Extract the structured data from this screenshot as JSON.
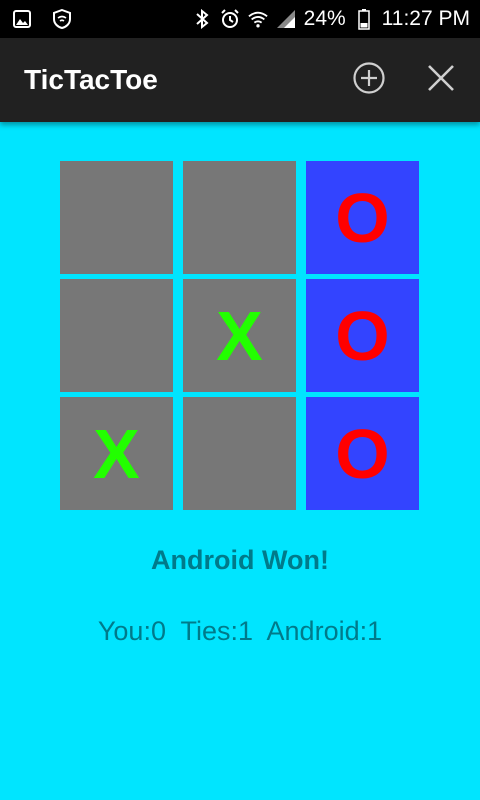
{
  "status_bar": {
    "battery": "24%",
    "time": "11:27 PM"
  },
  "app_bar": {
    "title": "TicTacToe"
  },
  "board": [
    {
      "mark": "",
      "winning": false
    },
    {
      "mark": "",
      "winning": false
    },
    {
      "mark": "O",
      "winning": true
    },
    {
      "mark": "",
      "winning": false
    },
    {
      "mark": "X",
      "winning": false
    },
    {
      "mark": "O",
      "winning": true
    },
    {
      "mark": "X",
      "winning": false
    },
    {
      "mark": "",
      "winning": false
    },
    {
      "mark": "O",
      "winning": true
    }
  ],
  "colors": {
    "background": "#00e5ff",
    "empty_cell": "#777777",
    "winning_cell": "#3344ff",
    "x_mark": "#22ff00",
    "o_mark": "#ff0000",
    "text": "#007a8a"
  },
  "result": "Android Won!",
  "scores": {
    "you": "You:0",
    "ties": "Ties:1",
    "android": "Android:1"
  }
}
